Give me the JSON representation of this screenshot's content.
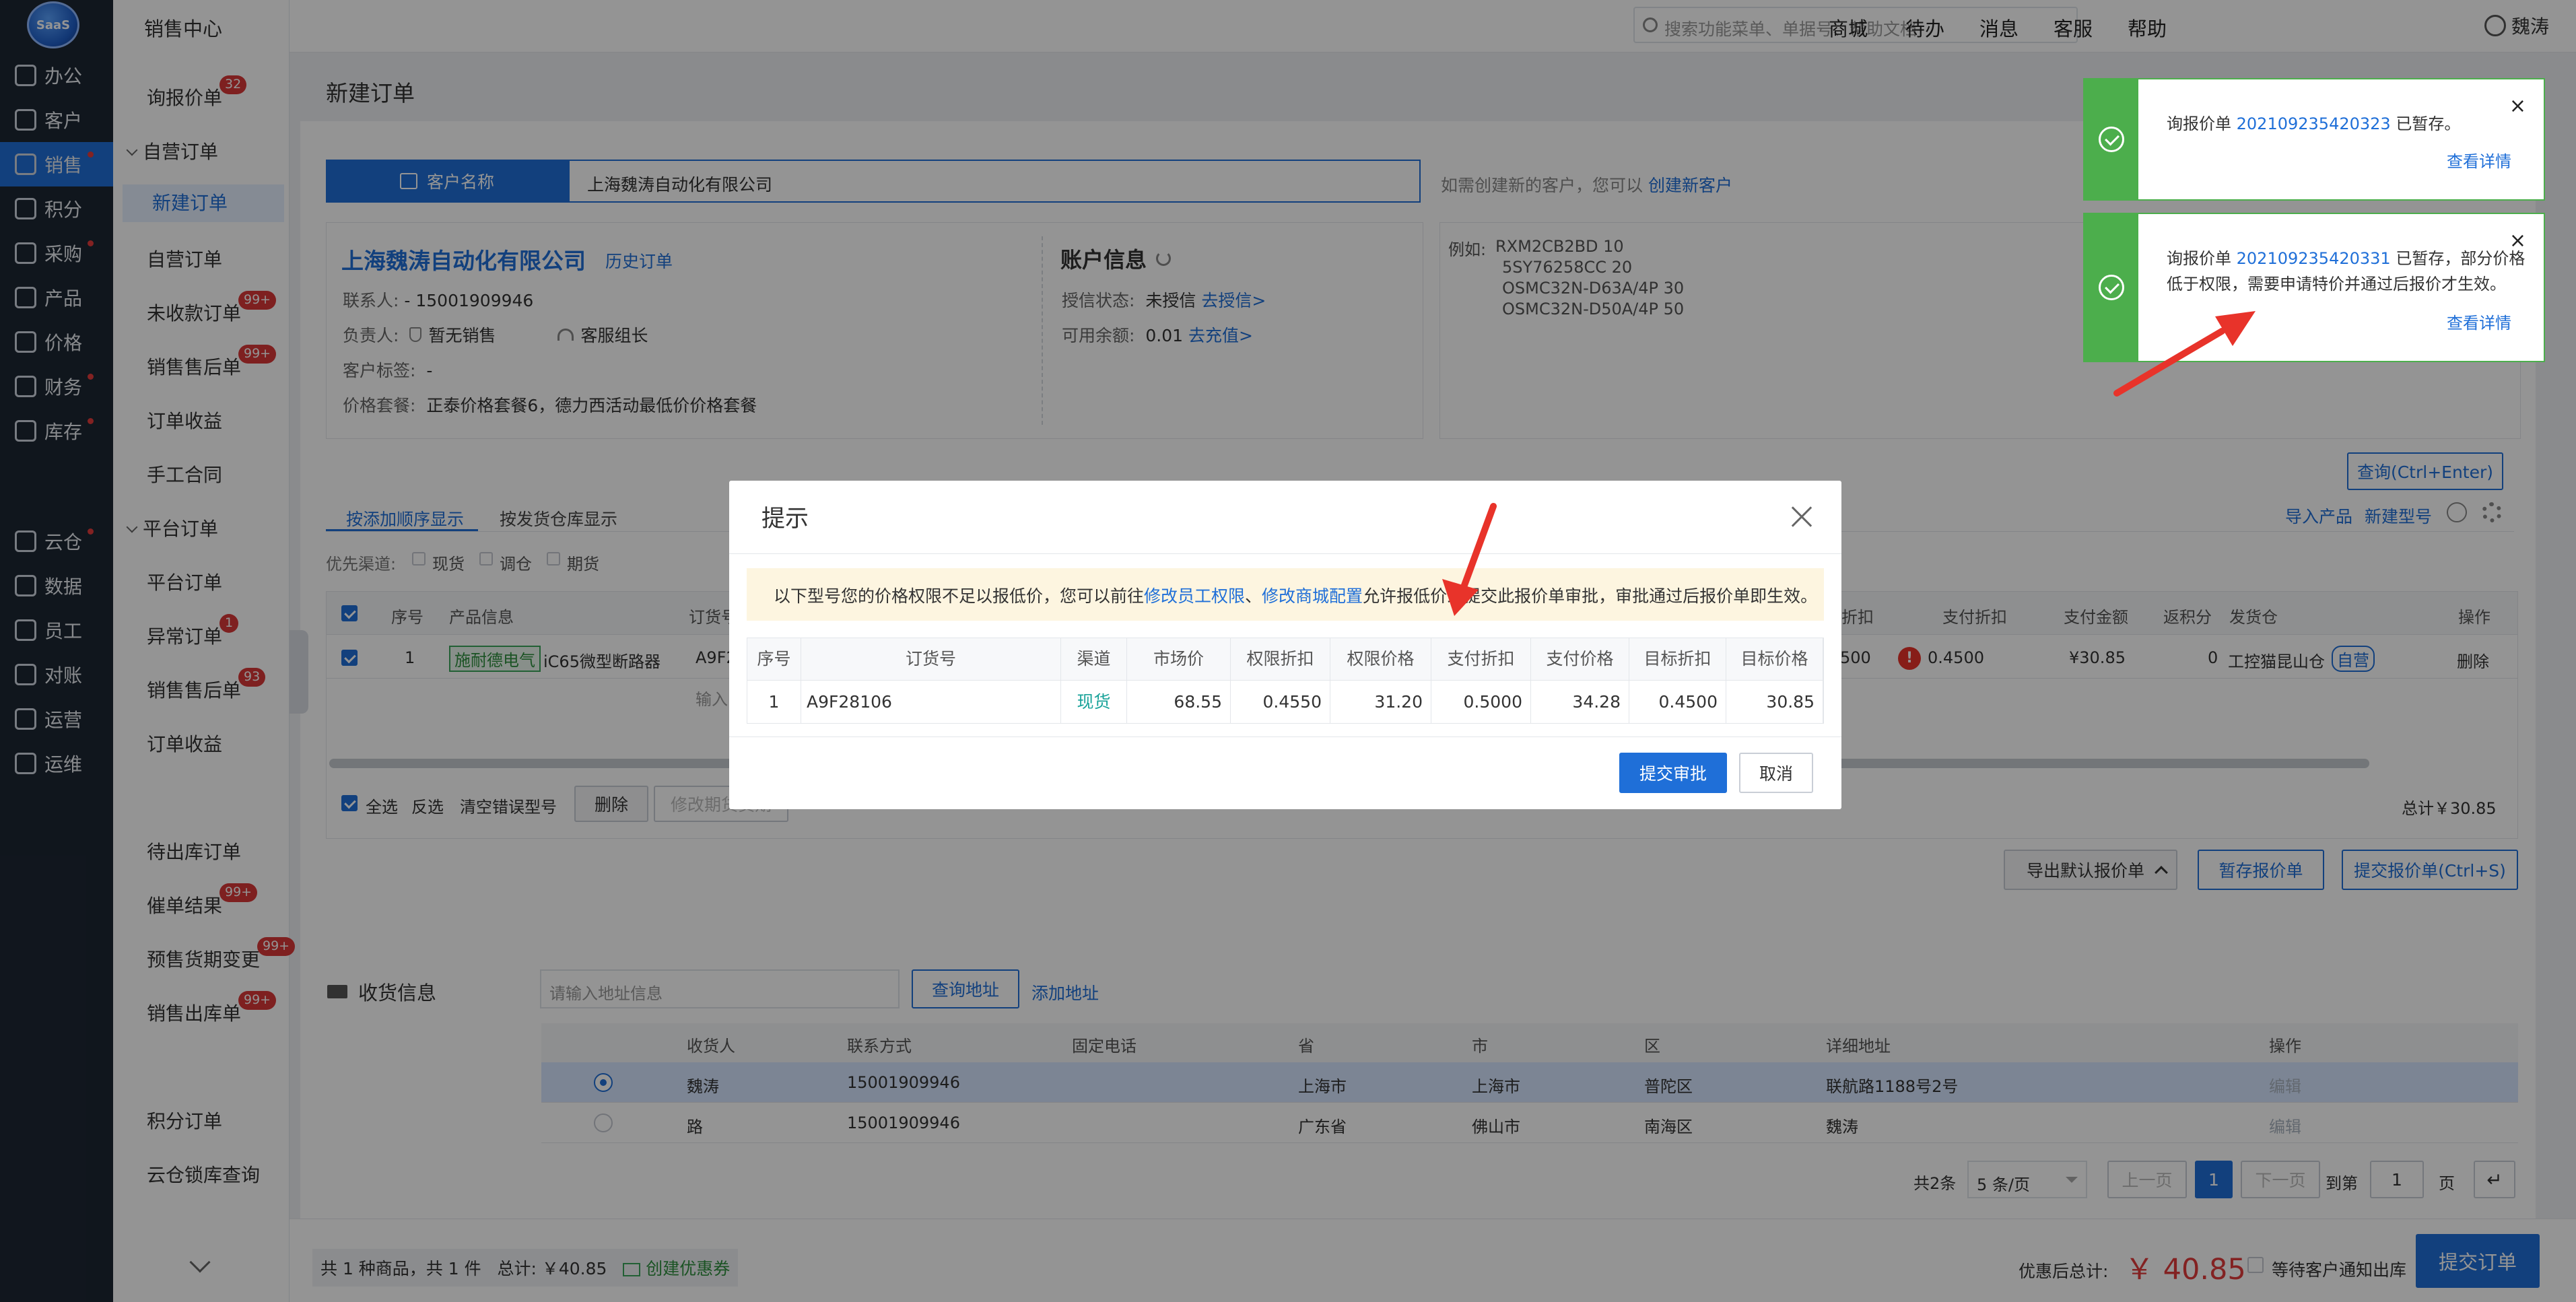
{
  "leftnav": {
    "logo": "SaaS",
    "items": [
      {
        "label": "办公",
        "icon": "desktop-icon",
        "dot": false
      },
      {
        "label": "客户",
        "icon": "user-icon",
        "dot": false
      },
      {
        "label": "销售",
        "icon": "sales-icon",
        "dot": true,
        "active": true
      },
      {
        "label": "积分",
        "icon": "diamond-icon",
        "dot": false
      },
      {
        "label": "采购",
        "icon": "cube-icon",
        "dot": true
      },
      {
        "label": "产品",
        "icon": "grid-icon",
        "dot": false
      },
      {
        "label": "价格",
        "icon": "price-icon",
        "dot": false
      },
      {
        "label": "财务",
        "icon": "finance-icon",
        "dot": true
      },
      {
        "label": "库存",
        "icon": "warehouse-icon",
        "dot": true
      },
      {
        "label": "云仓",
        "icon": "cloud-icon",
        "dot": true
      },
      {
        "label": "数据",
        "icon": "bar-chart-icon",
        "dot": false
      },
      {
        "label": "员工",
        "icon": "employee-icon",
        "dot": false
      },
      {
        "label": "对账",
        "icon": "reconcile-icon",
        "dot": false
      },
      {
        "label": "运营",
        "icon": "operations-icon",
        "dot": false
      },
      {
        "label": "运维",
        "icon": "maintenance-icon",
        "dot": false
      }
    ]
  },
  "subnav": {
    "title": "销售中心",
    "items": [
      {
        "label": "询报价单",
        "badge": "32"
      },
      {
        "label": "自营订单",
        "group": true
      },
      {
        "label": "新建订单",
        "active": true
      },
      {
        "label": "自营订单"
      },
      {
        "label": "未收款订单",
        "badge": "99+"
      },
      {
        "label": "销售售后单",
        "badge": "99+"
      },
      {
        "label": "订单收益"
      },
      {
        "label": "手工合同"
      },
      {
        "label": "平台订单",
        "group": true
      },
      {
        "label": "平台订单"
      },
      {
        "label": "异常订单",
        "badge": "1"
      },
      {
        "label": "销售售后单",
        "badge": "93"
      },
      {
        "label": "订单收益"
      },
      {
        "label": "待出库订单"
      },
      {
        "label": "催单结果",
        "badge": "99+"
      },
      {
        "label": "预售货期变更",
        "badge": "99+"
      },
      {
        "label": "销售出库单",
        "badge": "99+"
      },
      {
        "label": "积分订单"
      },
      {
        "label": "云仓锁库查询"
      }
    ]
  },
  "topbar": {
    "search_placeholder": "搜索功能菜单、单据号、帮助文档",
    "links": [
      "商城",
      "待办",
      "消息",
      "客服",
      "帮助"
    ],
    "user": "魏涛"
  },
  "page": {
    "title": "新建订单",
    "customer_label": "客户名称",
    "customer_value": "上海魏涛自动化有限公司",
    "customer_hint": "如需创建新的客户，您可以",
    "customer_hint_link": "创建新客户",
    "company_name": "上海魏涛自动化有限公司",
    "history_link": "历史订单",
    "contact_label": "联系人:",
    "contact_value": "- 15001909946",
    "owner_label": "负责人:",
    "owner_value": "暂无销售",
    "service_value": "客服组长",
    "tag_label": "客户标签:",
    "tag_value": "-",
    "price_pkg_label": "价格套餐:",
    "price_pkg_value": "正泰价格套餐6，德力西活动最低价价格套餐",
    "account_title": "账户信息",
    "credit_label": "授信状态:",
    "credit_value": "未授信",
    "credit_link": "去授信>",
    "balance_label": "可用余额:",
    "balance_value": "0.01",
    "balance_link": "去充值>",
    "example_label": "例如:",
    "examples": [
      "RXM2CB2BD 10",
      "5SY76258CC 20",
      "OSMC32N-D63A/4P 30",
      "OSMC32N-D50A/4P 50"
    ],
    "query_button": "查询(Ctrl+Enter)",
    "tab_order": "按添加顺序显示",
    "tab_warehouse": "按发货仓库显示",
    "import_link": "导入产品",
    "new_model_link": "新建型号",
    "channel_label": "优先渠道:",
    "channels": [
      "现货",
      "调仓",
      "期货"
    ],
    "table_headers": [
      "序号",
      "产品信息",
      "订货号",
      "折扣",
      "支付折扣",
      "支付金额",
      "返积分",
      "发货仓",
      "操作"
    ],
    "row": {
      "index": "1",
      "brand": "施耐德电气",
      "product": "iC65微型断路器",
      "code": "A9F2",
      "discount_tail": "500",
      "pay_discount": "0.4500",
      "pay_amount": "¥30.85",
      "points": "0",
      "warehouse": "工控猫昆山仓",
      "self_tag": "自营",
      "delete": "删除"
    },
    "input_hint": "输入",
    "select_all": "全选",
    "invert": "反选",
    "clear_wrong": "清空错误型号",
    "delete_btn": "删除",
    "modify_btn": "修改期货货期",
    "total": "总计￥30.85",
    "export_btn": "导出默认报价单",
    "save_quote_btn": "暂存报价单",
    "submit_quote_btn": "提交报价单(Ctrl+S)"
  },
  "shipping": {
    "title": "收货信息",
    "input_placeholder": "请输入地址信息",
    "query_btn": "查询地址",
    "add_link": "添加地址",
    "headers": [
      "收货人",
      "联系方式",
      "固定电话",
      "省",
      "市",
      "区",
      "详细地址",
      "操作"
    ],
    "rows": [
      {
        "name": "魏涛",
        "phone": "15001909946",
        "tel": "",
        "province": "上海市",
        "city": "上海市",
        "district": "普陀区",
        "address": "联航路1188号2号",
        "op": "编辑",
        "selected": true
      },
      {
        "name": "路",
        "phone": "15001909946",
        "tel": "",
        "province": "广东省",
        "city": "佛山市",
        "district": "南海区",
        "address": "魏涛",
        "op": "编辑",
        "selected": false
      }
    ],
    "pagination": {
      "total": "共2条",
      "page_size": "5 条/页",
      "prev": "上一页",
      "page": "1",
      "next": "下一页",
      "goto_label": "到第",
      "goto_value": "1",
      "page_unit": "页"
    }
  },
  "bottombar": {
    "summary": "共 1 种商品，共 1 件",
    "total_label": "总计:",
    "total_value": "￥40.85",
    "coupon": "创建优惠券",
    "discounted_label": "优惠后总计:",
    "discounted_value": "￥ 40.85",
    "notify_label": "等待客户通知出库",
    "submit_order": "提交订单"
  },
  "modal": {
    "title": "提示",
    "msg_prefix": "以下型号您的价格权限不足以报低价，您可以前往",
    "msg_link1": "修改员工权限",
    "msg_sep": "、",
    "msg_link2": "修改商城配置",
    "msg_suffix": "允许报低价或提交此报价单审批，审批通过后报价单即生效。",
    "headers": [
      "序号",
      "订货号",
      "渠道",
      "市场价",
      "权限折扣",
      "权限价格",
      "支付折扣",
      "支付价格",
      "目标折扣",
      "目标价格"
    ],
    "row": {
      "index": "1",
      "code": "A9F28106",
      "channel": "现货",
      "market_price": "68.55",
      "perm_discount": "0.4550",
      "perm_price": "31.20",
      "pay_discount": "0.5000",
      "pay_price": "34.28",
      "target_discount": "0.4500",
      "target_price": "30.85"
    },
    "submit_btn": "提交审批",
    "cancel_btn": "取消"
  },
  "notifications": [
    {
      "prefix": "询报价单",
      "id": "202109235420323",
      "line1_suffix": "已暂存。",
      "line2": "",
      "link": "查看详情"
    },
    {
      "prefix": "询报价单",
      "id": "202109235420331",
      "line1_suffix": "已暂存，部分价格",
      "line2": "低于权限，需要申请特价并通过后报价才生效。",
      "link": "查看详情"
    }
  ],
  "colors": {
    "primary": "#1f6fd8",
    "nav_bg": "#1d2633",
    "success": "#4cae4c",
    "danger": "#e23b3b",
    "annotation": "#e8332a"
  }
}
